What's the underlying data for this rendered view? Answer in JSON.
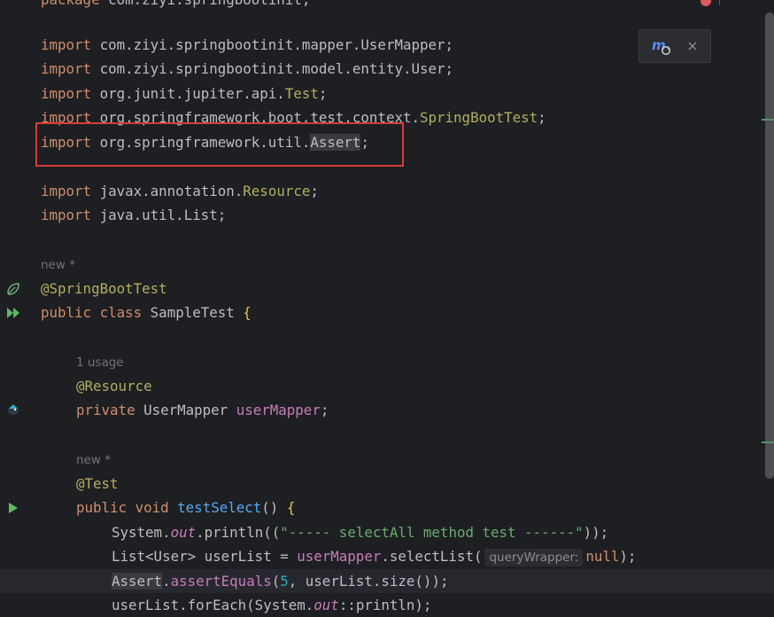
{
  "editor": {
    "lines": {
      "package_kw": "package",
      "package_name": " com.ziyi.springbootinit;",
      "import_kw": "import",
      "import1": " com.ziyi.springbootinit.mapper.UserMapper;",
      "import2": " com.ziyi.springbootinit.model.entity.User;",
      "import3_pkg": " org.junit.jupiter.api.",
      "import3_cls": "Test",
      "import4_pkg": " org.springframework.boot.test.context.",
      "import4_cls": "SpringBootTest",
      "import5_pkg": " org.springframework.util.",
      "import5_cls": "Assert",
      "import6_pkg": " javax.annotation.",
      "import6_cls": "Resource",
      "import7": " java.util.List;",
      "semicolon": ";",
      "new_hint_1": "new *",
      "anno_sbt": "@SpringBootTest",
      "public_kw": "public",
      "class_kw": "class",
      "class_name": " SampleTest ",
      "open_brace": "{",
      "usage_hint": "1 usage",
      "anno_resource": "@Resource",
      "private_kw": "private",
      "mapper_type": " UserMapper ",
      "mapper_field": "userMapper",
      "new_hint_2": "new *",
      "anno_test": "@Test",
      "void_kw": "void",
      "method_name": "testSelect",
      "method_rest": "() ",
      "sys": "System.",
      "out": "out",
      "println_open": ".println((",
      "str_literal": "\"----- selectAll method test ------\"",
      "println_close": "));",
      "list_decl": "List<User> userList = ",
      "select_call": ".selectList(",
      "param_hint": "queryWrapper:",
      "null_kw": "null",
      "select_close": ");",
      "assert_cls": "Assert",
      "assert_call": "assertEquals",
      "assert_open": "(",
      "num5": "5",
      "assert_rest": ", userList.size());",
      "foreach_pre": "userList.forEach(System.",
      "foreach_post": "::println);"
    }
  },
  "toolbar": {
    "close_label": "×",
    "maven_label": "m"
  },
  "colors": {
    "background": "#1e1f22",
    "keyword": "#cf8e6d",
    "annotation": "#b3ae60",
    "highlight_box": "#d93a3a"
  }
}
